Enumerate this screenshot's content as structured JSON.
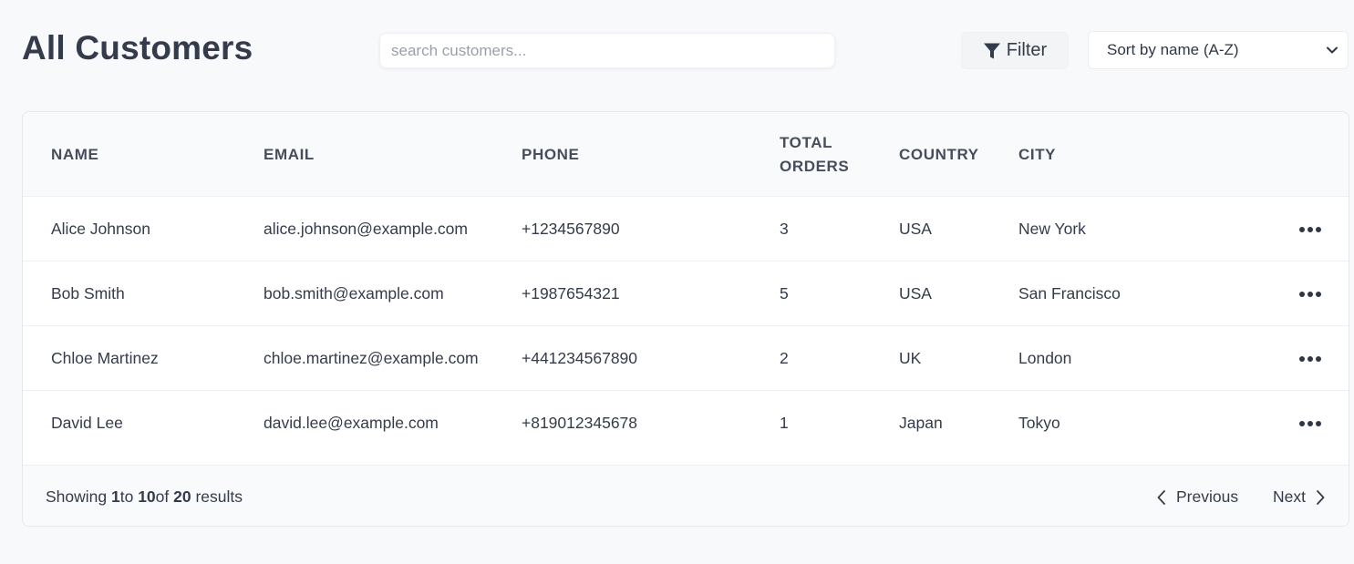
{
  "header": {
    "title": "All Customers",
    "search_placeholder": "search customers...",
    "filter_label": "Filter",
    "sort_selected": "Sort by name (A-Z)"
  },
  "table": {
    "columns": [
      "NAME",
      "EMAIL",
      "PHONE",
      "TOTAL ORDERS",
      "COUNTRY",
      "CITY"
    ],
    "rows": [
      {
        "name": "Alice Johnson",
        "email": "alice.johnson@example.com",
        "phone": "+1234567890",
        "orders": "3",
        "country": "USA",
        "city": "New York"
      },
      {
        "name": "Bob Smith",
        "email": "bob.smith@example.com",
        "phone": "+1987654321",
        "orders": "5",
        "country": "USA",
        "city": "San Francisco"
      },
      {
        "name": "Chloe Martinez",
        "email": "chloe.martinez@example.com",
        "phone": "+441234567890",
        "orders": "2",
        "country": "UK",
        "city": "London"
      },
      {
        "name": "David Lee",
        "email": "david.lee@example.com",
        "phone": "+819012345678",
        "orders": "1",
        "country": "Japan",
        "city": "Tokyo"
      }
    ]
  },
  "footer": {
    "showing_prefix": "Showing ",
    "from": "1",
    "to_word": "to ",
    "to": "10",
    "of_word": "of ",
    "total": "20",
    "results_word": " results",
    "previous_label": "Previous",
    "next_label": "Next"
  },
  "icons": {
    "filter": "funnel-icon",
    "sort": "chevron-down-icon",
    "row_actions": "more-horizontal-icon",
    "prev": "chevron-left-icon",
    "next": "chevron-right-icon"
  },
  "colors": {
    "background": "#f8f9fb",
    "text": "#343b4a",
    "header_bg": "#f9fafb",
    "border": "#e5e7eb"
  }
}
